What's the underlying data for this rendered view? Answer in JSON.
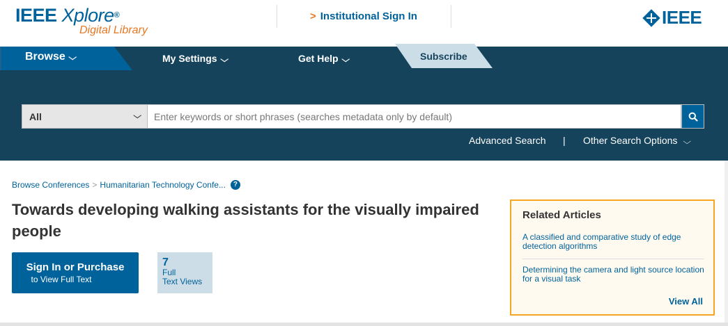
{
  "header": {
    "logo_main": "IEEE",
    "logo_xplore": "Xplore",
    "logo_reg": "®",
    "logo_sub": "Digital Library",
    "institutional_signin": "Institutional Sign In",
    "brand": "IEEE"
  },
  "nav": {
    "browse": "Browse",
    "my_settings": "My Settings",
    "get_help": "Get Help",
    "subscribe": "Subscribe"
  },
  "search": {
    "scope_selected": "All",
    "placeholder": "Enter keywords or short phrases (searches metadata only by default)",
    "advanced": "Advanced Search",
    "separator": "|",
    "other_options": "Other Search Options"
  },
  "breadcrumb": {
    "items": [
      "Browse Conferences",
      "Humanitarian Technology Confe..."
    ],
    "separator": ">"
  },
  "document": {
    "title": "Towards developing walking assistants for the visually impaired people",
    "signin_main": "Sign In or Purchase",
    "signin_sub": "to View Full Text",
    "metric_value": "7",
    "metric_label_1": "Full",
    "metric_label_2": "Text Views"
  },
  "related": {
    "title": "Related Articles",
    "articles": [
      "A classified and comparative study of edge detection algorithms",
      "Determining the camera and light source location for a visual task"
    ],
    "view_all": "View All"
  },
  "colors": {
    "brand_blue": "#00629b",
    "nav_dark": "#16435c",
    "accent_orange": "#e87722",
    "related_border": "#f5a623"
  }
}
